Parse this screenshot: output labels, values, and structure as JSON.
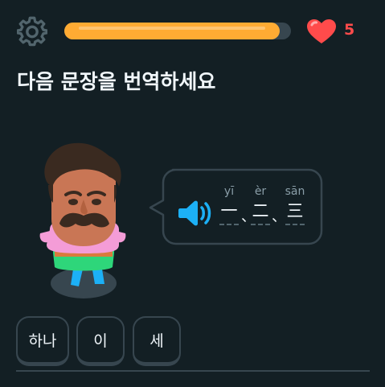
{
  "header": {
    "settings_icon": "gear-icon",
    "progress": 0.95,
    "progress_color": "#ffab33",
    "hearts_icon": "heart-icon",
    "hearts_count": "5",
    "hearts_color": "#ff4b4b"
  },
  "prompt": {
    "title": "다음 문장을 번역하세요"
  },
  "speech": {
    "speaker_icon": "speaker-icon",
    "accent": "#1cb0f6",
    "tokens": [
      {
        "pinyin": "yī",
        "hanzi": "一"
      },
      {
        "pinyin": "èr",
        "hanzi": "二"
      },
      {
        "pinyin": "sān",
        "hanzi": "三"
      }
    ],
    "separator": "、"
  },
  "word_bank": [
    "하나",
    "이",
    "세"
  ]
}
